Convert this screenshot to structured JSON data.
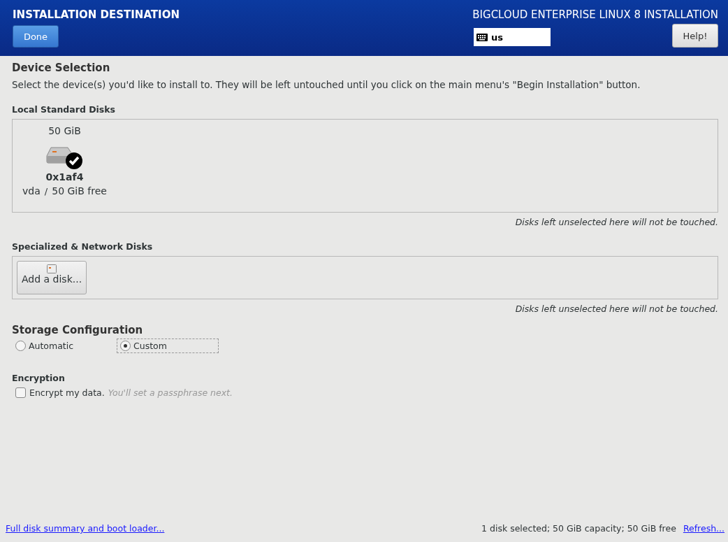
{
  "header": {
    "title": "INSTALLATION DESTINATION",
    "done_button": "Done",
    "product": "BIGCLOUD ENTERPRISE LINUX 8 INSTALLATION",
    "keyboard_layout": "us",
    "help_button": "Help!"
  },
  "device_selection": {
    "title": "Device Selection",
    "description": "Select the device(s) you'd like to install to.  They will be left untouched until you click on the main menu's \"Begin Installation\" button."
  },
  "local_disks": {
    "title": "Local Standard Disks",
    "disks": [
      {
        "size": "50 GiB",
        "name": "0x1af4",
        "device": "vda",
        "separator": "/",
        "free": "50 GiB free",
        "selected": true
      }
    ],
    "note": "Disks left unselected here will not be touched."
  },
  "network_disks": {
    "title": "Specialized & Network Disks",
    "add_button": "Add a disk...",
    "note": "Disks left unselected here will not be touched."
  },
  "storage_configuration": {
    "title": "Storage Configuration",
    "options": [
      {
        "label": "Automatic",
        "selected": false
      },
      {
        "label": "Custom",
        "selected": true
      }
    ]
  },
  "encryption": {
    "title": "Encryption",
    "checkbox": {
      "label": "Encrypt my data.",
      "checked": false
    },
    "hint": "You'll set a passphrase next."
  },
  "footer": {
    "summary_link": "Full disk summary and boot loader...",
    "status": "1 disk selected; 50 GiB capacity; 50 GiB free",
    "refresh_link": "Refresh..."
  }
}
